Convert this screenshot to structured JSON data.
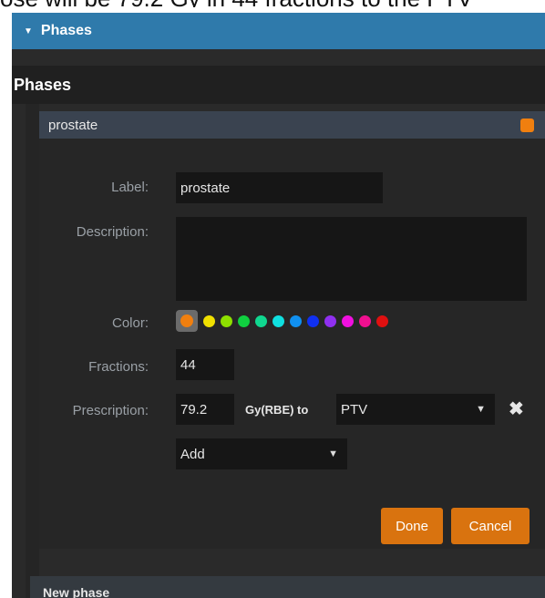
{
  "top_snippet": "ose will be 79.2 Gy in 44 fractions to the PTV",
  "section": {
    "title": "Phases"
  },
  "phases_title": "Phases",
  "phase": {
    "name": "prostate",
    "color": "#f07f0f",
    "label_caption": "Label:",
    "label_value": "prostate",
    "description_caption": "Description:",
    "description_value": "",
    "color_caption": "Color:",
    "swatches": [
      "#f07f0f",
      "#f0e000",
      "#8ee000",
      "#10d040",
      "#10d890",
      "#10e0e0",
      "#1090f0",
      "#1030f0",
      "#9030f0",
      "#f010e0",
      "#f01090",
      "#e01010"
    ],
    "fractions_caption": "Fractions:",
    "fractions_value": "44",
    "prescription_caption": "Prescription:",
    "prescription_value": "79.2",
    "prescription_unit": "Gy(RBE) to",
    "target_value": "PTV",
    "add_value": "Add",
    "done_label": "Done",
    "cancel_label": "Cancel"
  },
  "new_phase_label": "New phase"
}
